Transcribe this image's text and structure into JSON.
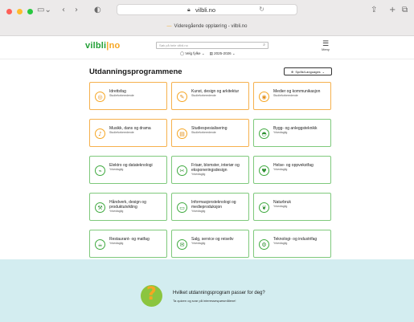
{
  "browser": {
    "host": "vilbli.no",
    "tab_title": "Videregående opplæring - vilbli.no"
  },
  "header": {
    "logo_pre": "vilbl",
    "logo_o": "i",
    "logo_post": "no",
    "search_placeholder": "Søk på hele vilbli.no",
    "county_label": "Velg fylke",
    "year_label": "2025-2026",
    "menu_label": "Meny"
  },
  "main": {
    "title": "Utdanningsprogrammene",
    "language_button": "Språk/Languages"
  },
  "programs": [
    {
      "name": "Idrettsfag",
      "type": "Studieforberedende",
      "color": "orange",
      "icon": "sports-icon"
    },
    {
      "name": "Kunst, design og arkitektur",
      "type": "Studieforberedende",
      "color": "orange",
      "icon": "pencil-icon"
    },
    {
      "name": "Medier og kommunikasjon",
      "type": "Studieforberedende",
      "color": "orange",
      "icon": "media-icon"
    },
    {
      "name": "Musikk, dans og drama",
      "type": "Studieforberedende",
      "color": "orange",
      "icon": "music-icon"
    },
    {
      "name": "Studiespesialisering",
      "type": "Studieforberedende",
      "color": "orange",
      "icon": "book-icon"
    },
    {
      "name": "Bygg- og anleggsteknikk",
      "type": "Yrkesfaglig",
      "color": "green",
      "icon": "helmet-icon"
    },
    {
      "name": "Elektro og datateknologi",
      "type": "Yrkesfaglig",
      "color": "green",
      "icon": "plug-icon"
    },
    {
      "name": "Frisør, blomster, interiør og eksponeringsdesign",
      "type": "Yrkesfaglig",
      "color": "green",
      "icon": "scissors-icon"
    },
    {
      "name": "Helse- og oppvekstfag",
      "type": "Yrkesfaglig",
      "color": "green",
      "icon": "health-icon"
    },
    {
      "name": "Håndverk, design og produktutvikling",
      "type": "Yrkesfaglig",
      "color": "green",
      "icon": "tools-icon"
    },
    {
      "name": "Informasjonsteknologi og medieproduksjon",
      "type": "Yrkesfaglig",
      "color": "green",
      "icon": "screen-icon"
    },
    {
      "name": "Naturbruk",
      "type": "Yrkesfaglig",
      "color": "green",
      "icon": "leaf-icon"
    },
    {
      "name": "Restaurant- og matfag",
      "type": "Yrkesfaglig",
      "color": "green",
      "icon": "food-icon"
    },
    {
      "name": "Salg, service og reiseliv",
      "type": "Yrkesfaglig",
      "color": "green",
      "icon": "service-icon"
    },
    {
      "name": "Teknologi- og industrifag",
      "type": "Yrkesfaglig",
      "color": "green",
      "icon": "gear-icon"
    }
  ],
  "banner": {
    "title": "Hvilket utdanningsprogram passer for deg?",
    "subtitle": "Ta quizen og svar på interessespørsmålene!"
  }
}
